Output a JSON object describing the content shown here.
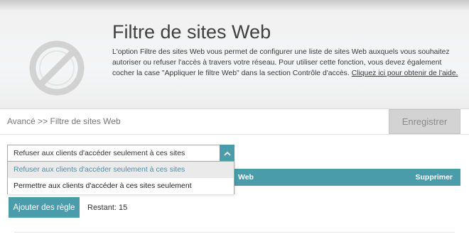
{
  "header": {
    "title": "Filtre de sites Web",
    "description": "L'option Filtre des sites Web vous permet de configurer une liste de sites Web auxquels vous souhaitez autoriser ou refuser l'accès à travers votre réseau. Pour utiliser cette fonction, vous devez également cocher la case \"Appliquer le filtre Web\" dans la section Contrôle d'accès. ",
    "help_link": "Cliquez ici pour obtenir de l'aide.",
    "icon": "web-filter-blocked-icon"
  },
  "breadcrumb": "Avancé >> Filtre de sites Web",
  "toolbar": {
    "save_label": "Enregistrer"
  },
  "filter_mode": {
    "selected": "Refuser aux clients d'accéder seulement à ces sites",
    "options": [
      "Refuser aux clients d'accéder seulement à ces sites",
      "Permettre aux clients d'accéder à ces sites seulement"
    ]
  },
  "table": {
    "columns": [
      "Web",
      "Supprimer"
    ]
  },
  "actions": {
    "add_rule_label": "Ajouter des règle",
    "remaining": "Restant: 15"
  },
  "colors": {
    "accent": "#4a9cab",
    "header_bg": "#f2f3f4",
    "disabled_button": "#d3d3d3"
  }
}
